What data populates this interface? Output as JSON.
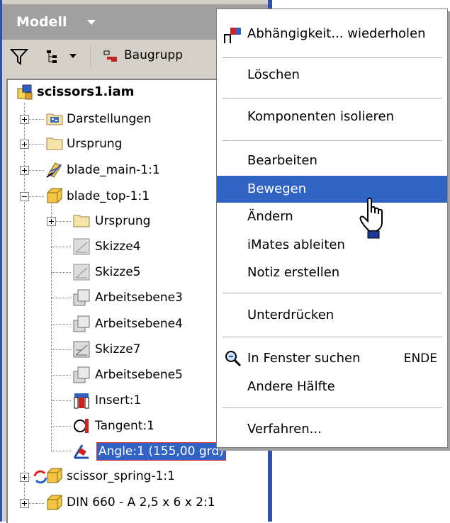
{
  "panel": {
    "title": "Modell",
    "toolbar": {
      "assembly_label": "Baugrupp"
    }
  },
  "tree": {
    "root": "scissors1.iam",
    "nodes": [
      {
        "label": "Darstellungen"
      },
      {
        "label": "Ursprung"
      },
      {
        "label": "blade_main-1:1"
      },
      {
        "label": "blade_top-1:1"
      },
      {
        "label": "Ursprung"
      },
      {
        "label": "Skizze4"
      },
      {
        "label": "Skizze5"
      },
      {
        "label": "Arbeitsebene3"
      },
      {
        "label": "Arbeitsebene4"
      },
      {
        "label": "Skizze7"
      },
      {
        "label": "Arbeitsebene5"
      },
      {
        "label": "Insert:1"
      },
      {
        "label": "Tangent:1"
      },
      {
        "label": "Angle:1 (155,00 grd)"
      },
      {
        "label": "scissor_spring-1:1"
      },
      {
        "label": "DIN 660 - A 2,5 x 6 x 2:1"
      }
    ]
  },
  "menu": {
    "items": [
      {
        "label": "Abhängigkeit... wiederholen"
      },
      {
        "label": "Löschen"
      },
      {
        "label": "Komponenten isolieren"
      },
      {
        "label": "Bearbeiten"
      },
      {
        "label": "Bewegen"
      },
      {
        "label": "Ändern"
      },
      {
        "label": "iMates ableiten"
      },
      {
        "label": "Notiz erstellen"
      },
      {
        "label": "Unterdrücken"
      },
      {
        "label": "In Fenster suchen",
        "shortcut": "ENDE"
      },
      {
        "label": "Andere Hälfte"
      },
      {
        "label": "Verfahren..."
      }
    ],
    "highlighted": "Bewegen"
  },
  "colors": {
    "highlight": "#3163c5",
    "panel_border": "#2f52a8"
  }
}
